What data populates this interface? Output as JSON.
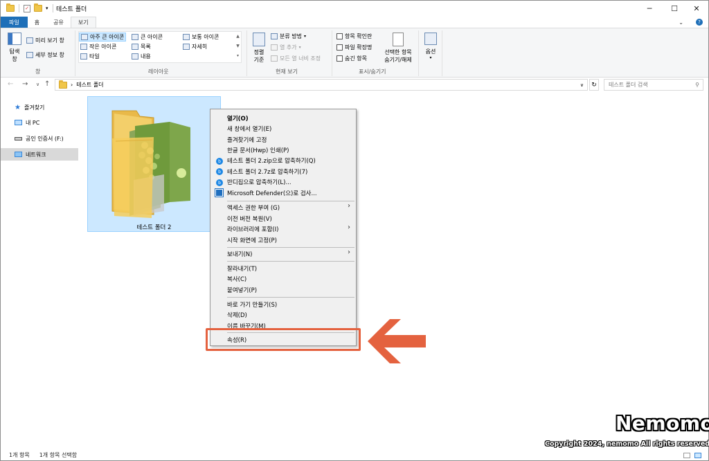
{
  "window": {
    "title": "테스트 폴더"
  },
  "ribbon": {
    "tabs": [
      "파일",
      "홈",
      "공유",
      "보기"
    ],
    "pane_group": {
      "nav_pane_label": "탐색 창",
      "preview_label": "미리 보기 창",
      "details_label": "세부 정보 창",
      "group_label": "창"
    },
    "layout_group": {
      "items": [
        "아주 큰 아이콘",
        "큰 아이콘",
        "보통 아이콘",
        "작은 아이콘",
        "목록",
        "자세히",
        "타일",
        "내용"
      ],
      "selected": "아주 큰 아이콘",
      "group_label": "레이아웃"
    },
    "current_view_group": {
      "sort_label": "정렬 기준",
      "group_by": "분류 방법",
      "add_column": "열 추가",
      "fit_columns": "모든 열 너비 조정",
      "group_label": "현재 보기"
    },
    "show_hide_group": {
      "checkboxes": [
        "항목 확인란",
        "파일 확장명",
        "숨긴 항목"
      ],
      "hide_selected": "선택한 항목 숨기기/해제",
      "group_label": "표시/숨기기"
    },
    "options_label": "옵션"
  },
  "address": {
    "path": "테스트 폴더",
    "search_placeholder": "테스트 폴더 검색"
  },
  "nav": {
    "items": [
      "즐겨찾기",
      "내 PC",
      "공인 인증서 (F:)",
      "네트워크"
    ],
    "selected": "네트워크"
  },
  "content": {
    "folder_name": "테스트 폴더 2"
  },
  "context_menu": {
    "items": [
      "열기(O)",
      "새 창에서 열기(E)",
      "즐겨찾기에 고정",
      "한글 문서(Hwp) 인쇄(P)",
      "테스트 폴더 2.zip으로 압축하기(Q)",
      "테스트 폴더 2.7z로 압축하기(7)",
      "반디집으로 압축하기(L)...",
      "Microsoft Defender(으)로 검사...",
      "액세스 권한 부여 (G)",
      "이전 버전 복원(V)",
      "라이브러리에 포함(I)",
      "시작 화면에 고정(P)",
      "보내기(N)",
      "잘라내기(T)",
      "복사(C)",
      "붙여넣기(P)",
      "바로 가기 만들기(S)",
      "삭제(D)",
      "이름 바꾸기(M)",
      "속성(R)"
    ],
    "highlighted": "속성(R)"
  },
  "status": {
    "count": "1개 항목",
    "selected": "1개 항목 선택함"
  },
  "watermark": {
    "brand": "Nemomo",
    "copyright": "Copyright 2024, nemomo All rights reserved."
  },
  "colors": {
    "accent": "#1e6fb8",
    "selection": "#cce8ff",
    "highlight_arrow": "#e4623f"
  }
}
